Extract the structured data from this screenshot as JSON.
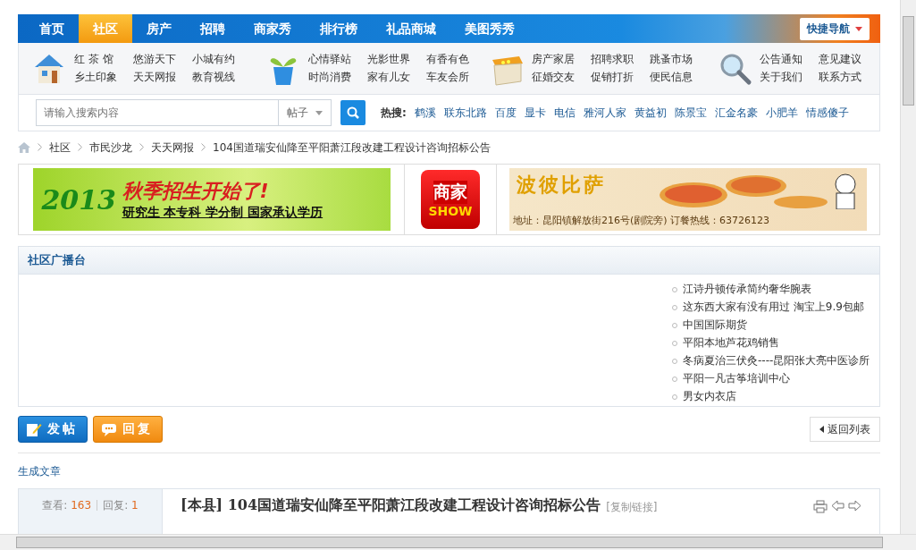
{
  "nav": {
    "items": [
      {
        "label": "首页",
        "selected": false
      },
      {
        "label": "社区",
        "selected": true
      },
      {
        "label": "房产",
        "selected": false
      },
      {
        "label": "招聘",
        "selected": false
      },
      {
        "label": "商家秀",
        "selected": false
      },
      {
        "label": "排行榜",
        "selected": false
      },
      {
        "label": "礼品商城",
        "selected": false
      },
      {
        "label": "美图秀秀",
        "selected": false
      }
    ],
    "quick_nav": "快捷导航"
  },
  "subnav": [
    {
      "kind": "house",
      "links": [
        "红 茶 馆",
        "悠游天下",
        "小城有约",
        "乡土印象",
        "天天网报",
        "教育视线"
      ]
    },
    {
      "kind": "plant",
      "links": [
        "心情驿站",
        "光影世界",
        "有香有色",
        "时尚消费",
        "家有儿女",
        "车友会所"
      ]
    },
    {
      "kind": "box",
      "links": [
        "房产家居",
        "招聘求职",
        "跳蚤市场",
        "征婚交友",
        "促销打折",
        "便民信息"
      ]
    },
    {
      "kind": "magnifier",
      "links": [
        "公告通知",
        "意见建议",
        "关于我们",
        "联系方式"
      ]
    }
  ],
  "search": {
    "placeholder": "请输入搜索内容",
    "scope": "帖子",
    "hot_label": "热搜:",
    "hot": [
      "鹤溪",
      "联东北路",
      "百度",
      "显卡",
      "电信",
      "雅河人家",
      "黄益初",
      "陈景宝",
      "汇金名豪",
      "小肥羊",
      "情感傻子"
    ]
  },
  "breadcrumb": [
    "社区",
    "市民沙龙",
    "天天网报",
    "104国道瑞安仙降至平阳萧江段改建工程设计咨询招标公告"
  ],
  "banners": [
    {
      "kind": "school",
      "year": "2013",
      "headline": "秋季招生开始了!",
      "subline": "研究生 本专科 学分制 国家承认学历"
    },
    {
      "kind": "shop",
      "top": "商家",
      "bottom": "SHOW"
    },
    {
      "kind": "pizza",
      "headline": "波彼比萨",
      "subline": "地址：昆阳镇解放街216号(剧院旁) 订餐热线：63726123"
    }
  ],
  "broadcast": {
    "title": "社区广播台",
    "items": [
      "江诗丹顿传承简约奢华腕表",
      "这东西大家有没有用过 淘宝上9.9包邮",
      "中国国际期货",
      "平阳本地芦花鸡销售",
      "冬病夏治三伏灸----昆阳张大亮中医诊所",
      "平阳一凡古筝培训中心",
      "男女内衣店"
    ]
  },
  "actions": {
    "post": "发帖",
    "reply": "回复",
    "back": "返回列表"
  },
  "generate_link": "生成文章",
  "thread": {
    "views_label": "查看:",
    "views": "163",
    "replies_label": "回复:",
    "replies": "1",
    "tag": "[本县]",
    "title": "104国道瑞安仙降至平阳萧江段改建工程设计咨询招标公告",
    "copy_link": "[复制链接]"
  }
}
